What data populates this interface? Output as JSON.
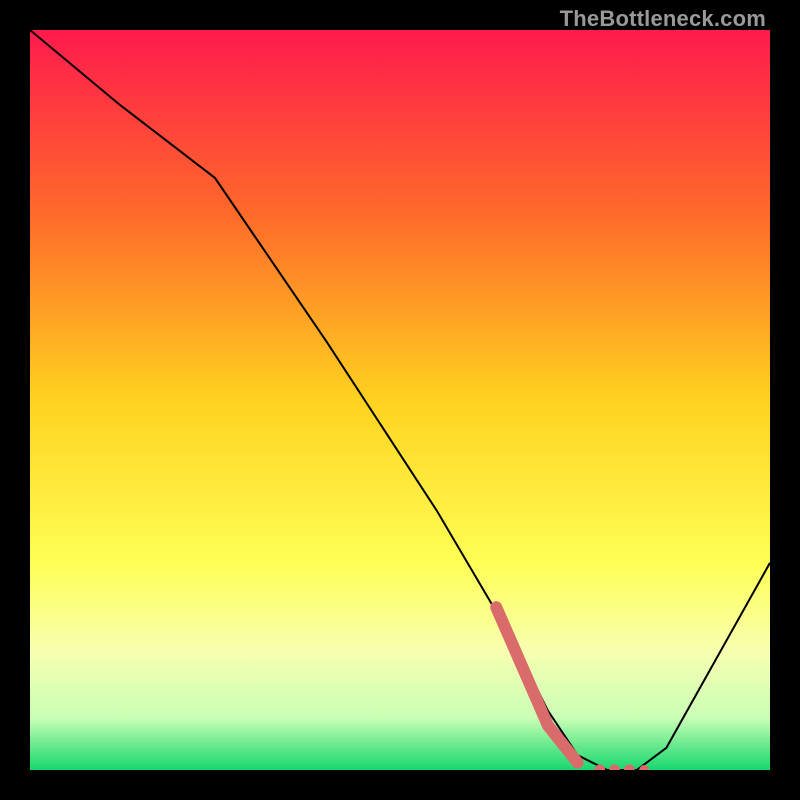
{
  "watermark": "TheBottleneck.com",
  "chart_data": {
    "type": "line",
    "title": "",
    "xlabel": "",
    "ylabel": "",
    "xlim": [
      0,
      100
    ],
    "ylim": [
      0,
      100
    ],
    "grid": false,
    "legend": false,
    "series": [
      {
        "name": "curve",
        "color": "#000000",
        "x": [
          0,
          12,
          25,
          40,
          55,
          65,
          70,
          74,
          78,
          82,
          86,
          100
        ],
        "y": [
          100,
          90,
          80,
          58,
          35,
          18,
          8,
          2,
          0,
          0,
          3,
          28
        ]
      },
      {
        "name": "highlight",
        "color": "#d96b6b",
        "style": "thick-then-dotted",
        "x": [
          63,
          70,
          74,
          77,
          79,
          81,
          83
        ],
        "y": [
          22,
          6,
          1,
          0,
          0,
          0,
          0
        ]
      }
    ],
    "background_gradient": {
      "stops": [
        {
          "offset": 0.0,
          "color": "#ff1a4d"
        },
        {
          "offset": 0.25,
          "color": "#ff6a2a"
        },
        {
          "offset": 0.5,
          "color": "#ffd21f"
        },
        {
          "offset": 0.72,
          "color": "#ffff55"
        },
        {
          "offset": 0.84,
          "color": "#f7ffb0"
        },
        {
          "offset": 0.93,
          "color": "#c9ffb5"
        },
        {
          "offset": 0.97,
          "color": "#5fe88a"
        },
        {
          "offset": 1.0,
          "color": "#17d86f"
        }
      ]
    }
  }
}
